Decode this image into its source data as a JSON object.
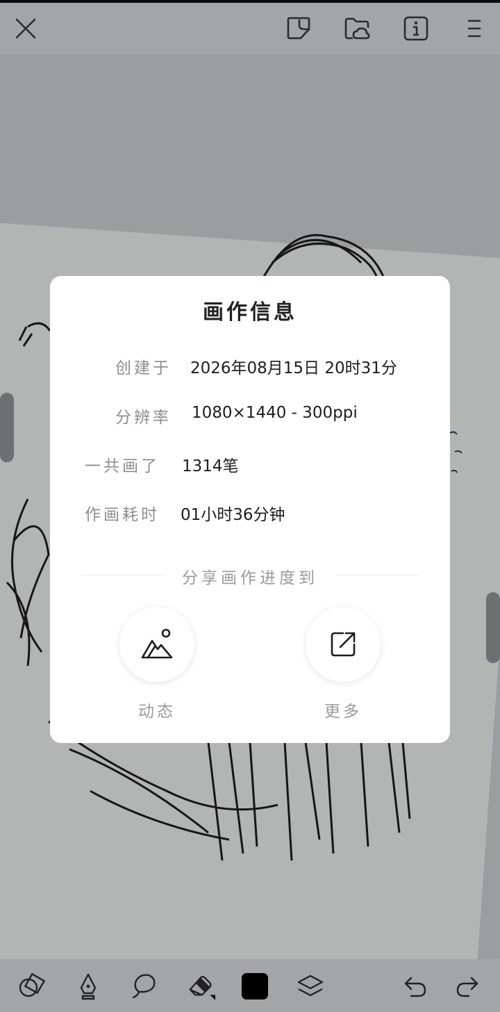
{
  "toolbar": {
    "close_icon": "close-icon",
    "icons": [
      "sticker-icon",
      "folder-cloud-icon",
      "info-icon",
      "menu-icon"
    ]
  },
  "dialog": {
    "title": "画作信息",
    "rows": [
      {
        "label": "创建于",
        "value": "2026年08月15日  20时31分"
      },
      {
        "label": "分辨率",
        "value": "1080×1440 - 300ppi"
      },
      {
        "label": "一共画了",
        "value": "1314笔"
      },
      {
        "label": "作画耗时",
        "value": "01小时36分钟"
      }
    ],
    "share_heading": "分享画作进度到",
    "share_options": [
      {
        "label": "动态",
        "icon": "mountain-image-icon"
      },
      {
        "label": "更多",
        "icon": "external-share-icon"
      }
    ]
  },
  "bottom_toolbar": {
    "icons": [
      "shapes-icon",
      "pen-nib-icon",
      "lasso-icon",
      "eraser-icon",
      "color-swatch",
      "layers-icon",
      "undo-icon",
      "redo-icon"
    ],
    "current_color": "#000000"
  },
  "colors": {
    "dialog_bg": "#ffffff",
    "overlay_bg": "#9b9d9e",
    "label_gray": "#8e8e8e",
    "value_dark": "#1d1d1d"
  }
}
